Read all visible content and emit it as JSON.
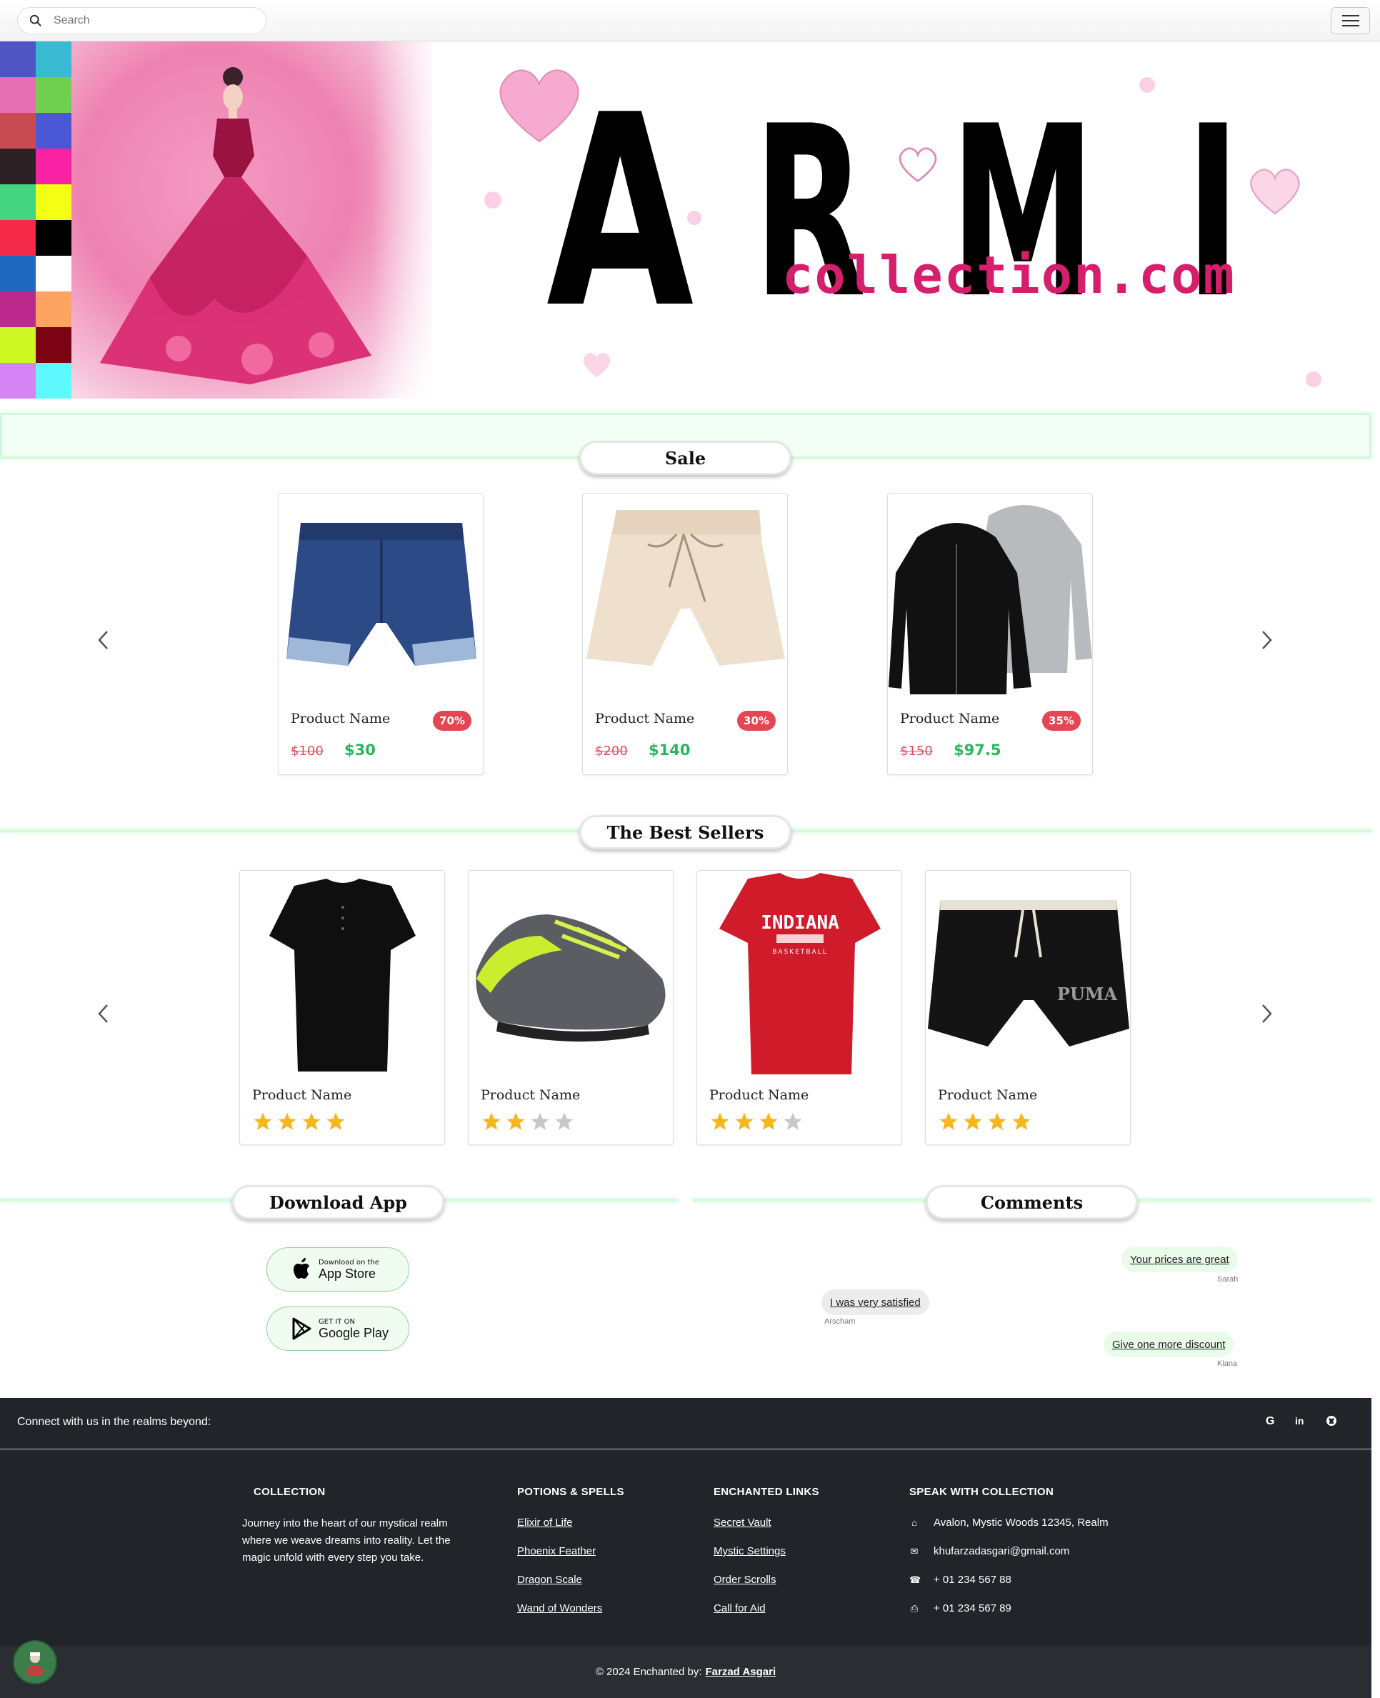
{
  "search": {
    "placeholder": "Search"
  },
  "palette": [
    "#4f55c2",
    "#3ab9d3",
    "#e66fb4",
    "#6fcf4f",
    "#c84b52",
    "#4a58d6",
    "#2d2126",
    "#fa22a4",
    "#43d57f",
    "#f3ff13",
    "#f52a48",
    "#000000",
    "#1f68c0",
    "#ffffff",
    "#bc2a8d",
    "#fda463",
    "#cdf824",
    "#7c0314",
    "#d684f5",
    "#5ef9ff"
  ],
  "hero": {
    "letters": [
      "A",
      "R",
      "M",
      "I"
    ],
    "subtitle": "collection.com"
  },
  "sale": {
    "title": "Sale",
    "items": [
      {
        "name": "Product Name",
        "discount": "70%",
        "old_price": "$100",
        "new_price": "$30",
        "image": "denim-shorts"
      },
      {
        "name": "Product Name",
        "discount": "30%",
        "old_price": "$200",
        "new_price": "$140",
        "image": "beige-shorts"
      },
      {
        "name": "Product Name",
        "discount": "35%",
        "old_price": "$150",
        "new_price": "$97.5",
        "image": "hoodies"
      }
    ]
  },
  "bestsellers": {
    "title": "The Best Sellers",
    "items": [
      {
        "name": "Product Name",
        "rating": 4,
        "image": "black-polo"
      },
      {
        "name": "Product Name",
        "rating": 2,
        "image": "sneakers"
      },
      {
        "name": "Product Name",
        "rating": 3,
        "image": "red-tshirt",
        "shirt_text": "INDIANA",
        "shirt_sub": "BASKETBALL"
      },
      {
        "name": "Product Name",
        "rating": 4,
        "image": "black-shorts",
        "brand_text": "PUMA"
      }
    ]
  },
  "download": {
    "title": "Download App",
    "appstore": {
      "small": "Download on the",
      "big": "App Store"
    },
    "googleplay": {
      "small": "GET IT ON",
      "big": "Google Play"
    }
  },
  "comments": {
    "title": "Comments",
    "items": [
      {
        "text": "Your prices are great",
        "author": "Sarah"
      },
      {
        "text": "I was very satisfied",
        "author": "Arscham"
      },
      {
        "text": "Give one more discount",
        "author": "Kiana"
      }
    ]
  },
  "footer": {
    "connect": "Connect with us in the realms beyond:",
    "social": [
      "G",
      "in",
      "gh"
    ],
    "collection": {
      "title": "COLLECTION",
      "text": "Journey into the heart of our mystical realm where we weave dreams into reality. Let the magic unfold with every step you take."
    },
    "potions": {
      "title": "POTIONS & SPELLS",
      "links": [
        "Elixir of Life",
        "Phoenix Feather",
        "Dragon Scale",
        "Wand of Wonders"
      ]
    },
    "links": {
      "title": "ENCHANTED LINKS",
      "links": [
        "Secret Vault",
        "Mystic Settings",
        "Order Scrolls",
        "Call for Aid"
      ]
    },
    "contact": {
      "title": "SPEAK WITH COLLECTION",
      "address": "Avalon, Mystic Woods 12345, Realm",
      "email": "khufarzadasgari@gmail.com",
      "phone": "+ 01 234 567 88",
      "fax": "+ 01 234 567 89"
    },
    "copyright": "© 2024 Enchanted by:",
    "author": "Farzad Asgari"
  },
  "colors": {
    "accent_green": "#2bb55c",
    "discount_red": "#e64553",
    "footer_bg": "#212529",
    "brand_pink": "#d61f6c"
  }
}
